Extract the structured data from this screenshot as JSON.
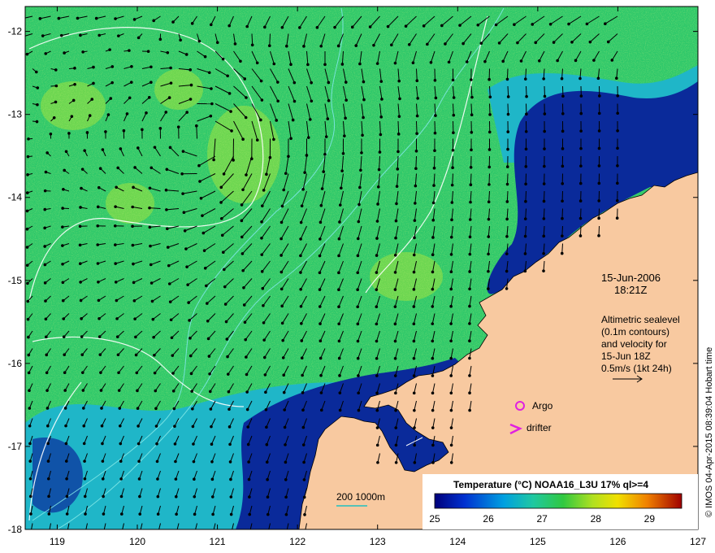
{
  "map": {
    "lon_ticks": [
      "119",
      "120",
      "121",
      "122",
      "123",
      "124",
      "125",
      "126",
      "127"
    ],
    "lat_ticks": [
      "-12",
      "-13",
      "-14",
      "-15",
      "-16",
      "-17",
      "-18"
    ],
    "lon_range": [
      118.6,
      127
    ],
    "lat_range": [
      -18,
      -11.7
    ]
  },
  "annotations": {
    "date": "15-Jun-2006",
    "time": "18:21Z",
    "sealevel_lines": [
      "Altimetric sealevel",
      "(0.1m contours)",
      "and velocity for",
      "15-Jun 18Z",
      "0.5m/s (1kt 24h)"
    ],
    "argo_label": "Argo",
    "drifter_label": "drifter",
    "depth_label": "200  1000m"
  },
  "colorbar": {
    "title": "Temperature (°C) NOAA16_L3U 17% ql>=4",
    "ticks": [
      "25",
      "26",
      "27",
      "28",
      "29"
    ],
    "range": [
      25,
      29.6
    ]
  },
  "credit": "© IMOS 04-Apr-2015 08:39:04 Hobart time",
  "colors": {
    "land": "#f8c9a0",
    "sea_green": "#2ec86a",
    "sea_cyan": "#1fb6c8",
    "sea_blue": "#0a2a9a",
    "argo": "#e020e0"
  }
}
